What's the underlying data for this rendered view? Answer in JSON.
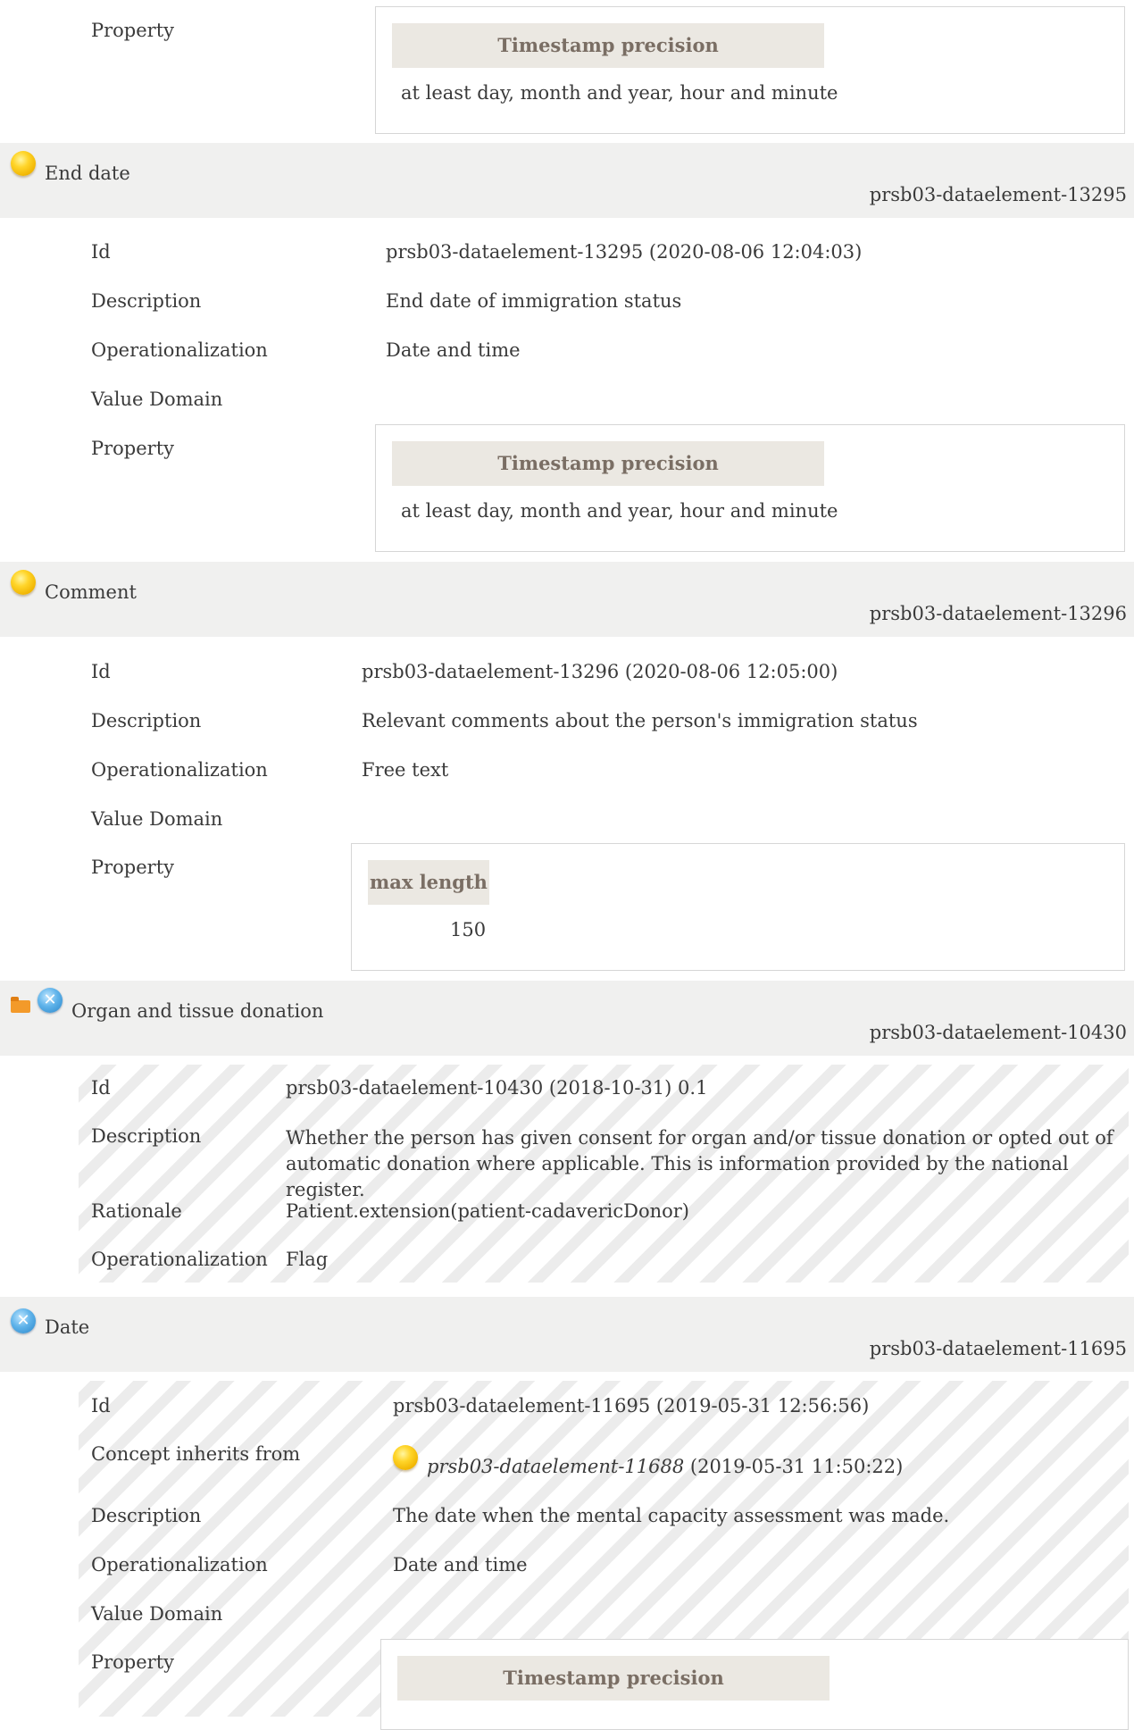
{
  "top_property": {
    "label": "Property",
    "heading": "Timestamp precision",
    "value": "at least day, month and year, hour and minute"
  },
  "sections": [
    {
      "title": "End date",
      "header_id": "prsb03-dataelement-13295",
      "rows": {
        "id_label": "Id",
        "id_value": "prsb03-dataelement-13295 (2020-08-06 12:04:03)",
        "desc_label": "Description",
        "desc_value": "End date of immigration status",
        "op_label": "Operationalization",
        "op_value": "Date and time",
        "vd_label": "Value Domain",
        "prop_label": "Property"
      },
      "property": {
        "heading": "Timestamp precision",
        "value": "at least day, month and year, hour and minute"
      }
    },
    {
      "title": "Comment",
      "header_id": "prsb03-dataelement-13296",
      "rows": {
        "id_label": "Id",
        "id_value": "prsb03-dataelement-13296 (2020-08-06 12:05:00)",
        "desc_label": "Description",
        "desc_value": "Relevant comments about the person's immigration status",
        "op_label": "Operationalization",
        "op_value": "Free text",
        "vd_label": "Value Domain",
        "prop_label": "Property"
      },
      "property": {
        "heading": "max length",
        "value": "150"
      }
    },
    {
      "title": "Organ and tissue donation",
      "header_id": "prsb03-dataelement-10430",
      "rows": {
        "id_label": "Id",
        "id_value": "prsb03-dataelement-10430 (2018-10-31) 0.1",
        "desc_label": "Description",
        "desc_value": "Whether the person has given consent for organ and/or tissue donation or opted out of automatic donation where applicable. This is information provided by the national register.",
        "rat_label": "Rationale",
        "rat_value": "Patient.extension(patient-cadavericDonor)",
        "op_label": "Operationalization",
        "op_value": "Flag"
      }
    },
    {
      "title": "Date",
      "header_id": "prsb03-dataelement-11695",
      "rows": {
        "id_label": "Id",
        "id_value": "prsb03-dataelement-11695 (2019-05-31 12:56:56)",
        "inh_label": "Concept inherits from",
        "inh_link": "prsb03-dataelement-11688",
        "inh_date": " (2019-05-31 11:50:22)",
        "desc_label": "Description",
        "desc_value": "The date when the mental capacity assessment was made.",
        "op_label": "Operationalization",
        "op_value": "Date and time",
        "vd_label": "Value Domain",
        "prop_label": "Property"
      },
      "property": {
        "heading": "Timestamp precision"
      }
    }
  ],
  "icons": {
    "status_draft": "yellow-circle-icon",
    "status_cancelled": "blue-x-circle-icon",
    "folder": "open-folder-icon",
    "cancel_glyph": "✕"
  }
}
